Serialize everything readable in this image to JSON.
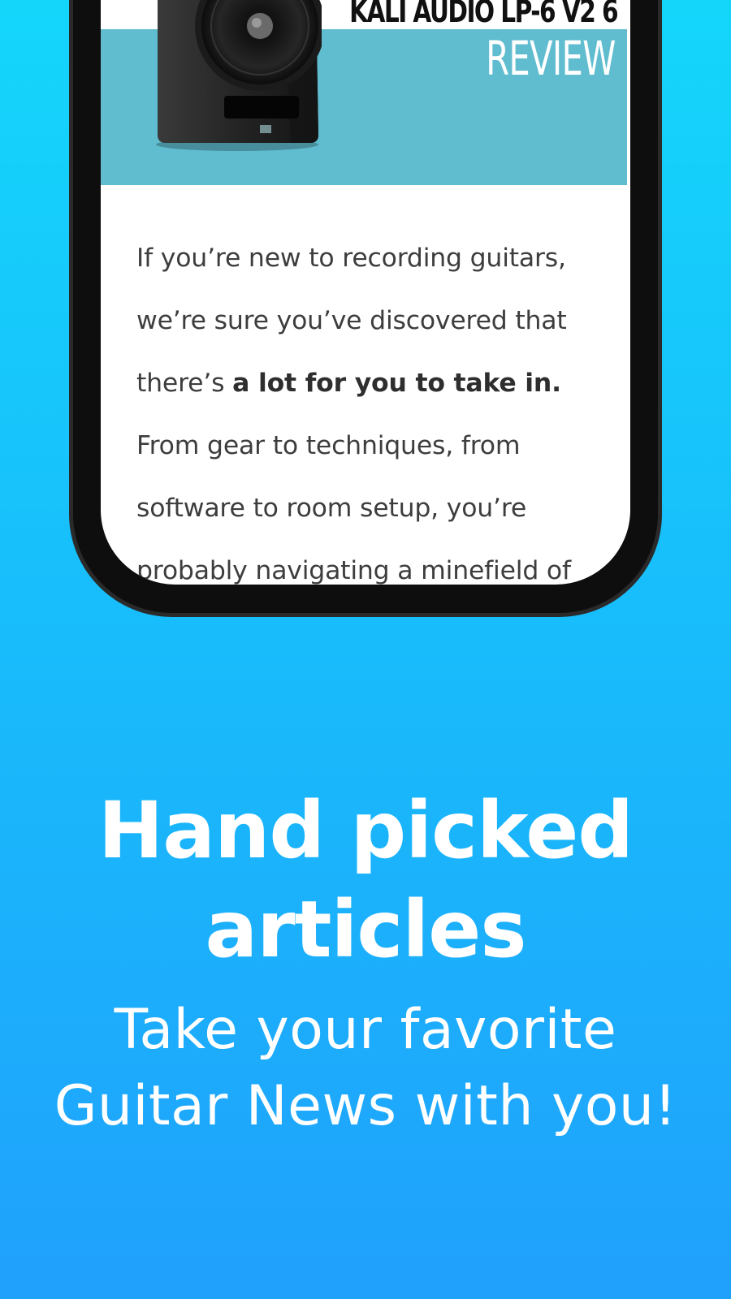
{
  "banner": {
    "title": "KALI AUDIO LP-6 V2 6",
    "subtitle": "REVIEW",
    "band_color": "#60bccf",
    "image_icon": "studio-monitor-speaker-icon"
  },
  "article": {
    "intro": "If you’re new to recording guitars, we’re sure you’ve discovered that there’s ",
    "emphasis": "a lot for you to take in.",
    "continuation": " From gear to techniques, from software to room setup, you’re probably navigating a minefield of"
  },
  "promo": {
    "headline_line1": "Hand picked",
    "headline_line2": "articles",
    "tagline_line1": "Take your favorite",
    "tagline_line2": "Guitar News with you!"
  },
  "colors": {
    "background_top": "#14d6fb",
    "background_bottom": "#20a1fc",
    "phone_frame": "#0e0e0e"
  }
}
